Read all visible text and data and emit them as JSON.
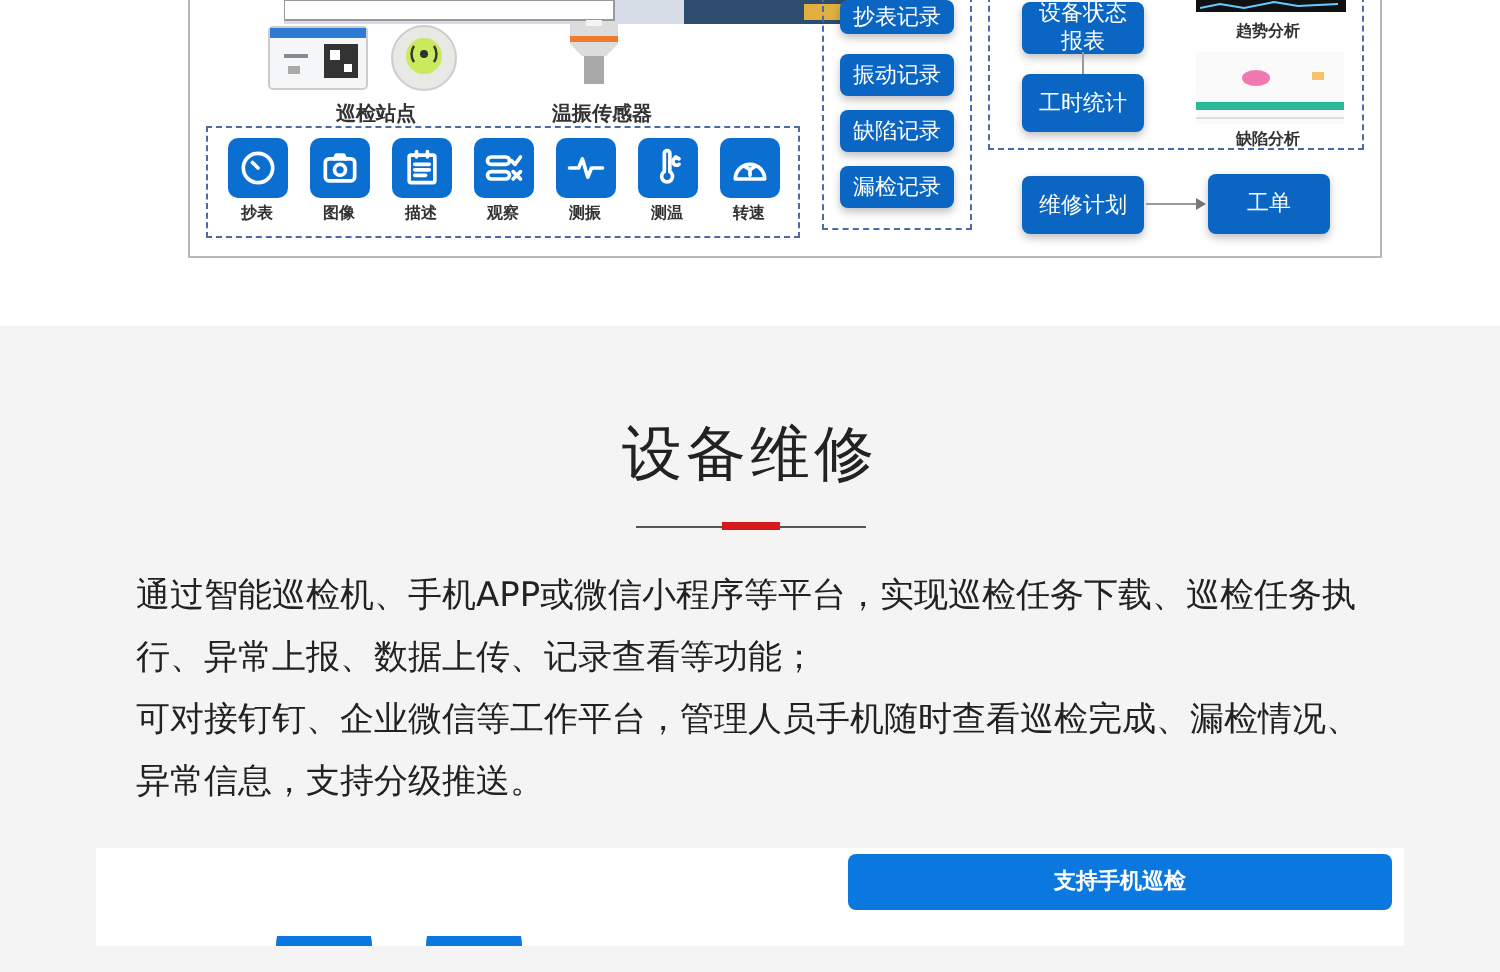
{
  "diagram": {
    "station_label": "巡检站点",
    "sensor_label": "温振传感器",
    "functions": [
      {
        "label": "抄表",
        "kind": "gauge"
      },
      {
        "label": "图像",
        "kind": "camera"
      },
      {
        "label": "描述",
        "kind": "note"
      },
      {
        "label": "观察",
        "kind": "check"
      },
      {
        "label": "测振",
        "kind": "pulse"
      },
      {
        "label": "测温",
        "kind": "thermo"
      },
      {
        "label": "转速",
        "kind": "fan"
      }
    ],
    "records": [
      "抄表记录",
      "振动记录",
      "缺陷记录",
      "漏检记录"
    ],
    "reports": [
      "设备状态报表",
      "工时统计"
    ],
    "charts": [
      "趋势分析",
      "缺陷分析"
    ],
    "plan": "维修计划",
    "work_order": "工单"
  },
  "section": {
    "title": "设备维修",
    "paragraphs": [
      "通过智能巡检机、手机APP或微信小程序等平台，实现巡检任务下载、巡检任务执行、异常上报、数据上传、记录查看等功能；",
      "可对接钉钉、企业微信等工作平台，管理人员手机随时查看巡检完成、漏检情况、异常信息，支持分级推送。"
    ]
  },
  "feature_button": "支持手机巡检"
}
